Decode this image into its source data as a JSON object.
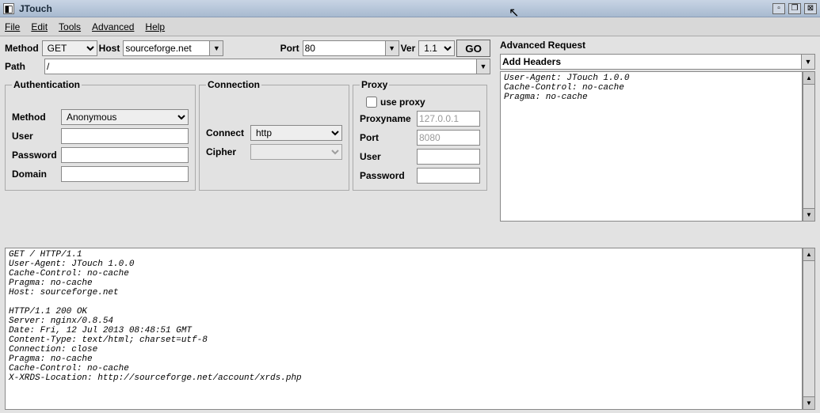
{
  "window": {
    "title": "JTouch"
  },
  "menu": {
    "file": "File",
    "edit": "Edit",
    "tools": "Tools",
    "advanced": "Advanced",
    "help": "Help"
  },
  "toolbar": {
    "method_label": "Method",
    "method_value": "GET",
    "host_label": "Host",
    "host_value": "sourceforge.net",
    "port_label": "Port",
    "port_value": "80",
    "ver_label": "Ver",
    "ver_value": "1.1",
    "go_label": "GO",
    "path_label": "Path",
    "path_value": "/"
  },
  "auth": {
    "legend": "Authentication",
    "method_label": "Method",
    "method_value": "Anonymous",
    "user_label": "User",
    "user_value": "",
    "password_label": "Password",
    "password_value": "",
    "domain_label": "Domain",
    "domain_value": ""
  },
  "conn": {
    "legend": "Connection",
    "connect_label": "Connect",
    "connect_value": "http",
    "cipher_label": "Cipher",
    "cipher_value": ""
  },
  "proxy": {
    "legend": "Proxy",
    "use_proxy_label": "use proxy",
    "name_label": "Proxyname",
    "name_value": "127.0.0.1",
    "port_label": "Port",
    "port_value": "8080",
    "user_label": "User",
    "user_value": "",
    "password_label": "Password",
    "password_value": ""
  },
  "adv": {
    "title": "Advanced Request",
    "add_headers_label": "Add Headers",
    "headers_text": "User-Agent: JTouch 1.0.0\nCache-Control: no-cache\nPragma: no-cache"
  },
  "output": "GET / HTTP/1.1\nUser-Agent: JTouch 1.0.0\nCache-Control: no-cache\nPragma: no-cache\nHost: sourceforge.net\n\nHTTP/1.1 200 OK\nServer: nginx/0.8.54\nDate: Fri, 12 Jul 2013 08:48:51 GMT\nContent-Type: text/html; charset=utf-8\nConnection: close\nPragma: no-cache\nCache-Control: no-cache\nX-XRDS-Location: http://sourceforge.net/account/xrds.php"
}
